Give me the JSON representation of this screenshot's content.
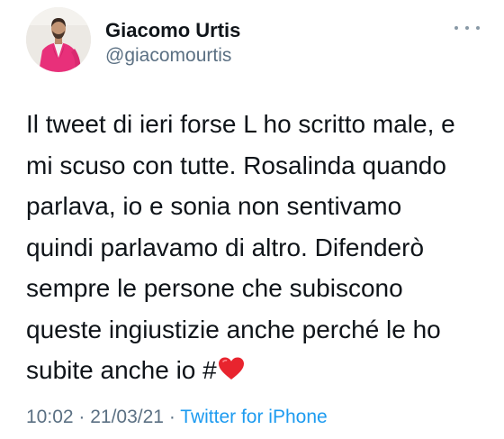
{
  "author": {
    "display_name": "Giacomo Urtis",
    "handle": "@giacomourtis",
    "avatar_icon": "profile-photo"
  },
  "tweet": {
    "lines": [
      "Il tweet di ieri forse L ho scritto male, e",
      "mi scuso con tutte. Rosalinda quando",
      "parlava, io e sonia non sentivamo",
      "quindi parlavamo di altro. Difenderò",
      "sempre le persone che subiscono",
      "queste ingiustizie anche perché le ho",
      "subite anche io #"
    ],
    "trailing_emoji": "red-heart",
    "time": "10:02",
    "separator": " · ",
    "date": "21/03/21",
    "source": "Twitter for iPhone"
  },
  "menu": {
    "icon": "more-icon"
  },
  "colors": {
    "text": "#0f1419",
    "secondary": "#5b7083",
    "link": "#1d9bf0",
    "heart": "#e8242e"
  }
}
